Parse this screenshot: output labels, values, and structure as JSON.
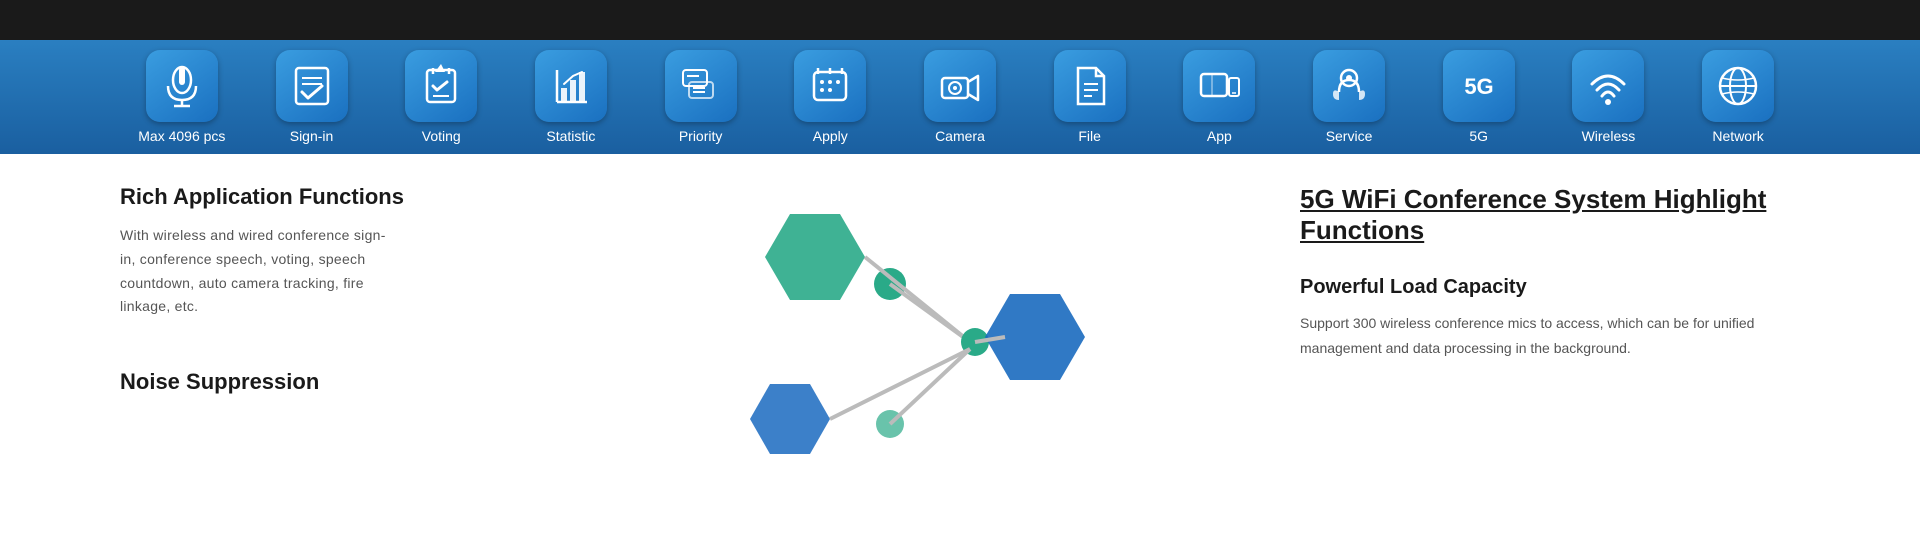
{
  "topBar": {
    "height": 40
  },
  "navBar": {
    "items": [
      {
        "id": "max4096",
        "label": "Max 4096 pcs",
        "icon": "mic"
      },
      {
        "id": "signin",
        "label": "Sign-in",
        "icon": "signin"
      },
      {
        "id": "voting",
        "label": "Voting",
        "icon": "voting"
      },
      {
        "id": "statistic",
        "label": "Statistic",
        "icon": "statistic"
      },
      {
        "id": "priority",
        "label": "Priority",
        "icon": "priority"
      },
      {
        "id": "apply",
        "label": "Apply",
        "icon": "apply"
      },
      {
        "id": "camera",
        "label": "Camera",
        "icon": "camera"
      },
      {
        "id": "file",
        "label": "File",
        "icon": "file"
      },
      {
        "id": "app",
        "label": "App",
        "icon": "app"
      },
      {
        "id": "service",
        "label": "Service",
        "icon": "service"
      },
      {
        "id": "5g",
        "label": "5G",
        "icon": "5g"
      },
      {
        "id": "wireless",
        "label": "Wireless",
        "icon": "wireless"
      },
      {
        "id": "network",
        "label": "Network",
        "icon": "network"
      }
    ]
  },
  "leftSection": {
    "title1": "Rich Application Functions",
    "body1": "With wireless and wired conference sign-in, conference speech, voting, speech countdown, auto camera tracking, fire linkage, etc.",
    "title2": "Noise Suppression"
  },
  "rightSection": {
    "highlightTitle": "5G WiFi Conference System  Highlight Functions",
    "subtitle1": "Powerful Load Capacity",
    "body1": "Support 300 wireless conference mics to access, which can be  for unified management and data processing in the background."
  }
}
